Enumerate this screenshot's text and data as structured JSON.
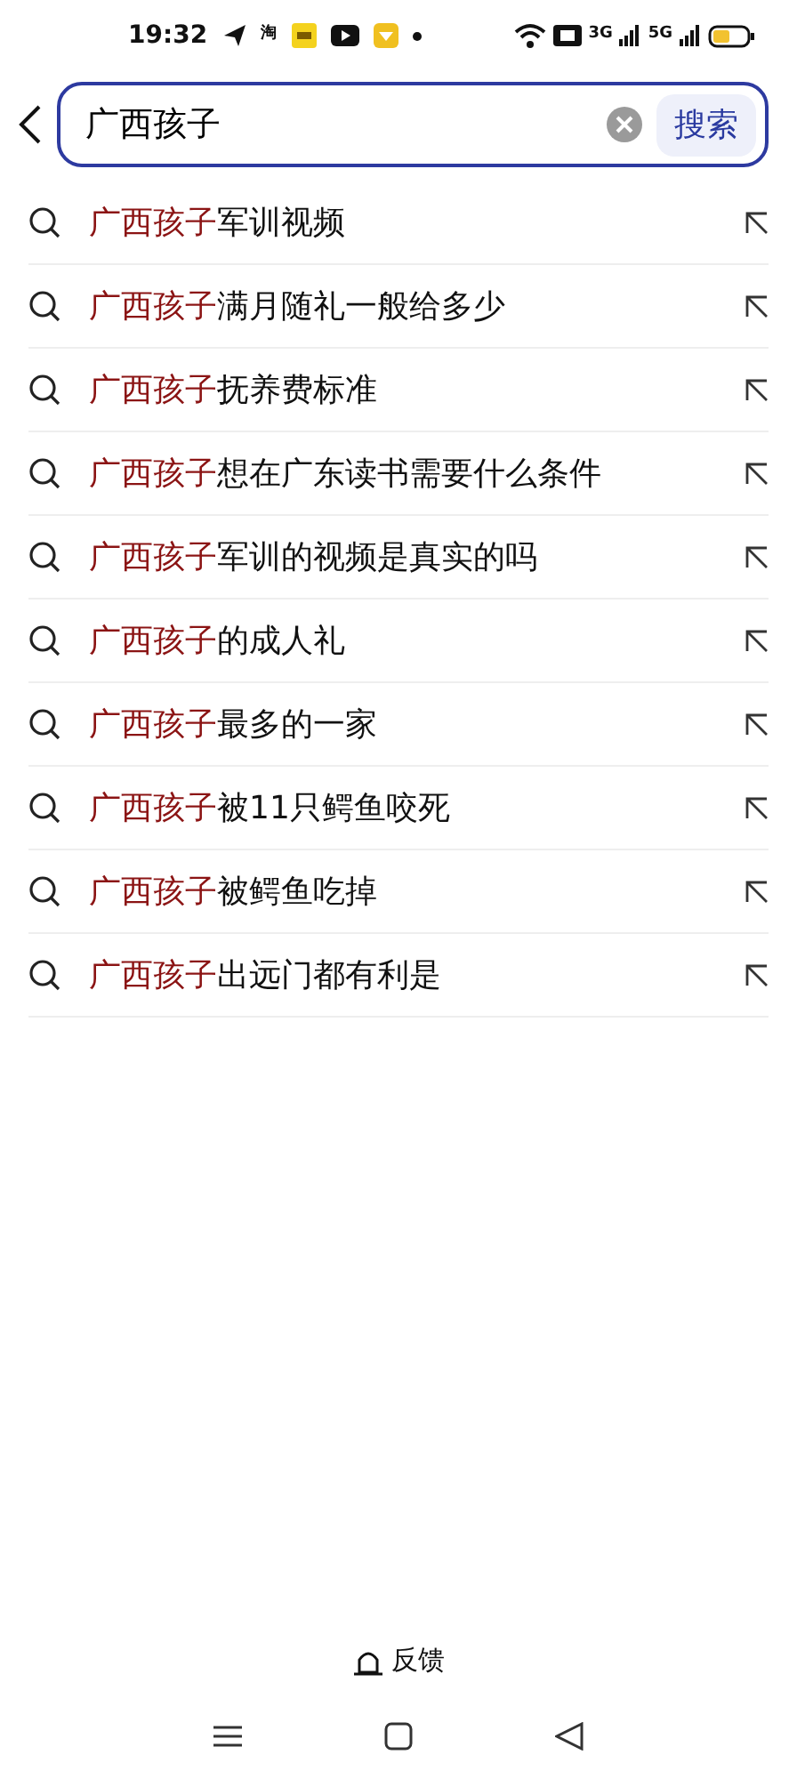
{
  "status_bar": {
    "time": "19:32",
    "app_glyph": "淘",
    "network_labels": [
      "3G",
      "5G"
    ]
  },
  "search": {
    "value": "广西孩子",
    "button": "搜索"
  },
  "suggestions": [
    {
      "highlight": "广西孩子",
      "rest": "军训视频"
    },
    {
      "highlight": "广西孩子",
      "rest": "满月随礼一般给多少"
    },
    {
      "highlight": "广西孩子",
      "rest": "抚养费标准"
    },
    {
      "highlight": "广西孩子",
      "rest": "想在广东读书需要什么条件"
    },
    {
      "highlight": "广西孩子",
      "rest": "军训的视频是真实的吗"
    },
    {
      "highlight": "广西孩子",
      "rest": "的成人礼"
    },
    {
      "highlight": "广西孩子",
      "rest": "最多的一家"
    },
    {
      "highlight": "广西孩子",
      "rest": "被11只鳄鱼咬死"
    },
    {
      "highlight": "广西孩子",
      "rest": "被鳄鱼吃掉"
    },
    {
      "highlight": "广西孩子",
      "rest": "出远门都有利是"
    }
  ],
  "feedback": "反馈"
}
